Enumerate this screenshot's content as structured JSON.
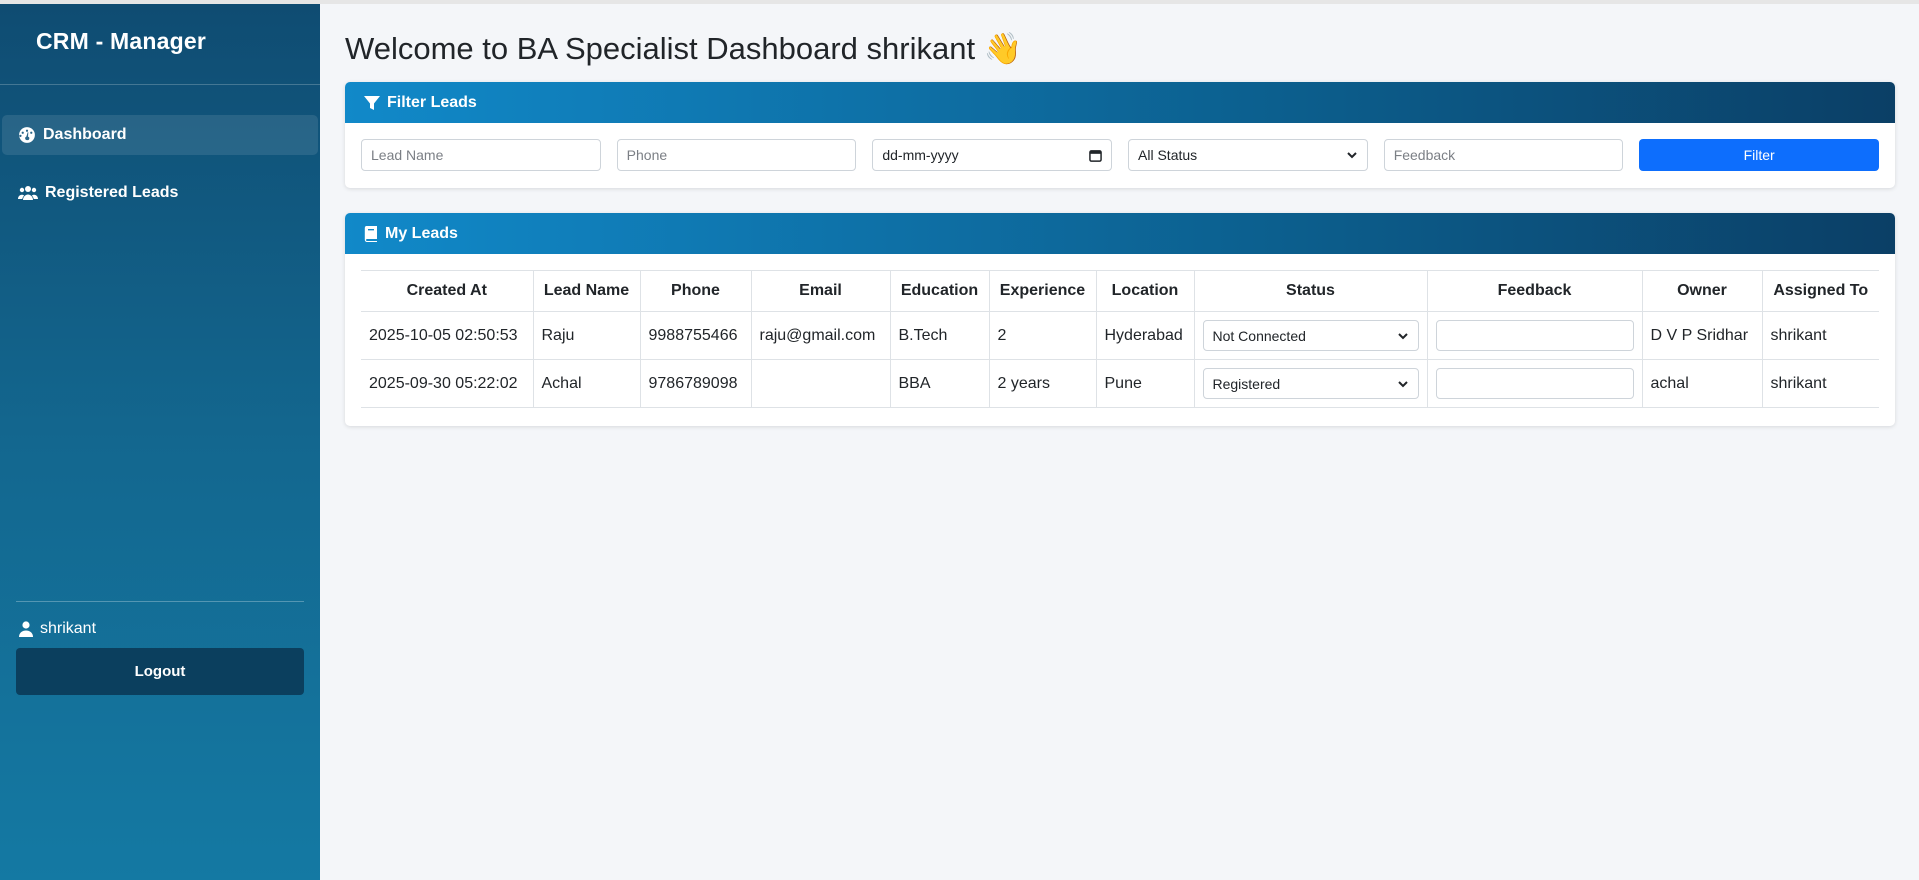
{
  "sidebar": {
    "brand": "CRM - Manager",
    "items": [
      {
        "label": "Dashboard",
        "icon": "gauge-icon",
        "active": true
      },
      {
        "label": "Registered Leads",
        "icon": "users-icon",
        "active": false
      }
    ],
    "user": "shrikant",
    "logout_label": "Logout"
  },
  "main": {
    "title": "Welcome to BA Specialist Dashboard shrikant 👋",
    "filter": {
      "header": "Filter Leads",
      "lead_name_placeholder": "Lead Name",
      "phone_placeholder": "Phone",
      "date_placeholder": "dd-mm-yyyy",
      "status_selected": "All Status",
      "feedback_placeholder": "Feedback",
      "button_label": "Filter"
    },
    "leads": {
      "header": "My Leads",
      "columns": [
        "Created At",
        "Lead Name",
        "Phone",
        "Email",
        "Education",
        "Experience",
        "Location",
        "Status",
        "Feedback",
        "Owner",
        "Assigned To"
      ],
      "rows": [
        {
          "created_at": "2025-10-05 02:50:53",
          "lead_name": "Raju",
          "phone": "9988755466",
          "email": "raju@gmail.com",
          "education": "B.Tech",
          "experience": "2",
          "location": "Hyderabad",
          "status": "Not Connected",
          "feedback": "",
          "owner": "D V P Sridhar",
          "assigned_to": "shrikant"
        },
        {
          "created_at": "2025-09-30 05:22:02",
          "lead_name": "Achal",
          "phone": "9786789098",
          "email": "",
          "education": "BBA",
          "experience": "2 years",
          "location": "Pune",
          "status": "Registered",
          "feedback": "",
          "owner": "achal",
          "assigned_to": "shrikant"
        }
      ]
    }
  },
  "colors": {
    "sidebar_top": "#0f4c72",
    "sidebar_bottom": "#1479a3",
    "primary_button": "#0d6efd",
    "header_gradient_start": "#1189c9",
    "header_gradient_end": "#0b3f66"
  }
}
